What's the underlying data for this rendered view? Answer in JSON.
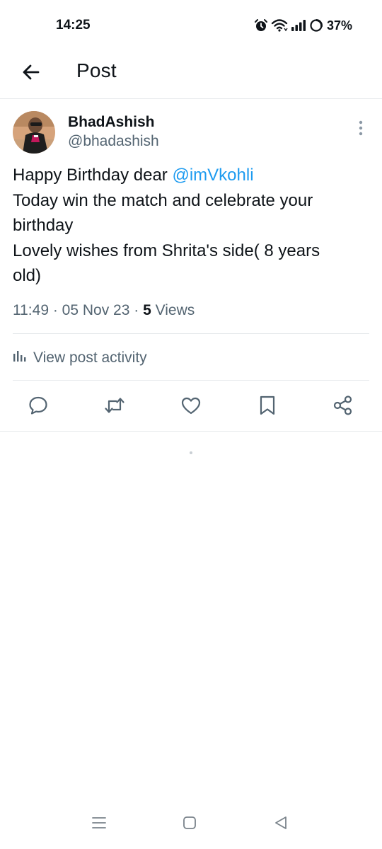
{
  "status_bar": {
    "time": "14:25",
    "battery_percent": "37%",
    "icons": [
      "alarm-icon",
      "wifi-icon",
      "signal-icon",
      "battery-icon"
    ]
  },
  "header": {
    "back_icon": "arrow-left-icon",
    "title": "Post"
  },
  "post": {
    "author": {
      "display_name": "BhadAshish",
      "handle": "@bhadashish"
    },
    "text": {
      "line1_prefix": "Happy Birthday dear ",
      "mention": "@imVkohli",
      "line2": "Today win the match and celebrate your",
      "line3": "birthday",
      "line4": "Lovely wishes from Shrita's side( 8 years",
      "line5": "old)"
    },
    "meta": {
      "time": "11:49",
      "separator": " · ",
      "date": "05 Nov 23",
      "views_count": "5",
      "views_label": " Views"
    },
    "activity_label": "View post activity",
    "actions": [
      "reply-icon",
      "repost-icon",
      "like-icon",
      "bookmark-icon",
      "share-icon"
    ]
  },
  "nav_bar": [
    "recents-icon",
    "home-icon",
    "back-icon"
  ],
  "colors": {
    "accent": "#1d9bf0",
    "text_primary": "#0f1419",
    "text_secondary": "#536471",
    "divider": "#e6e9ec"
  }
}
